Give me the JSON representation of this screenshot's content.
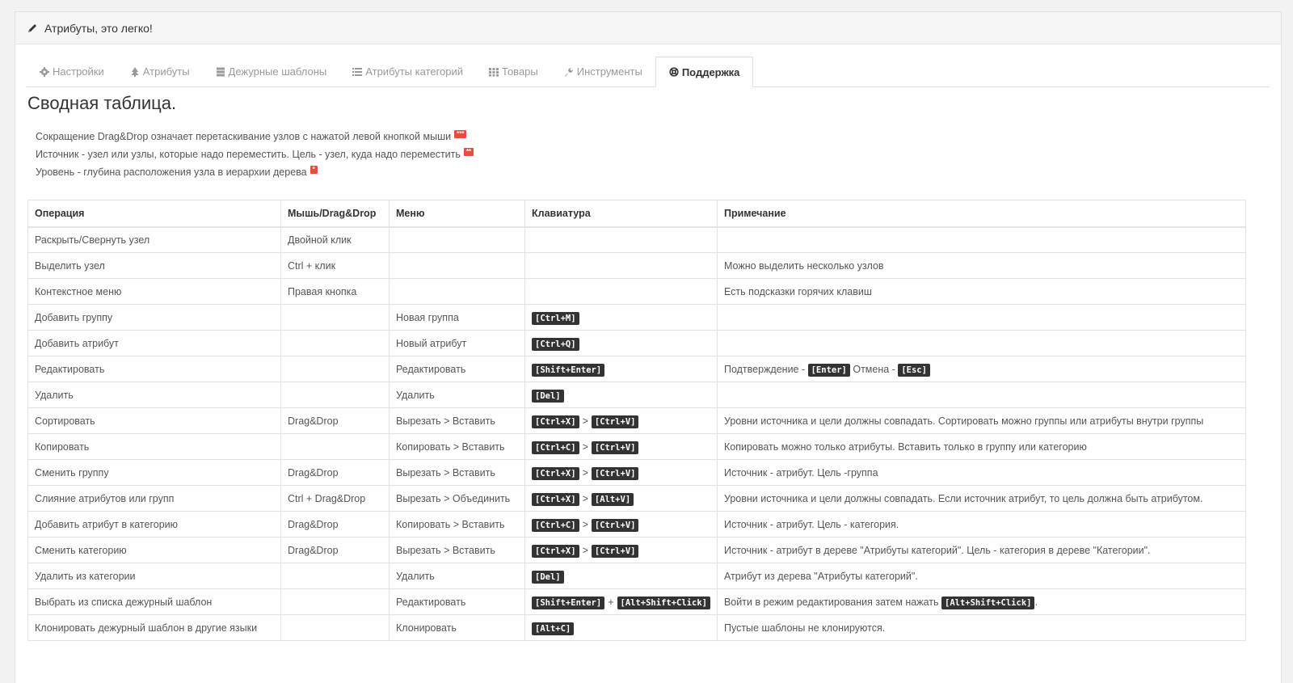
{
  "header": {
    "title": "Атрибуты, это легко!"
  },
  "tabs": [
    {
      "label": "Настройки",
      "icon": "gear-icon"
    },
    {
      "label": "Атрибуты",
      "icon": "tree-icon"
    },
    {
      "label": "Дежурные шаблоны",
      "icon": "database-icon"
    },
    {
      "label": "Атрибуты категорий",
      "icon": "list-icon"
    },
    {
      "label": "Товары",
      "icon": "grid-icon"
    },
    {
      "label": "Инструменты",
      "icon": "wrench-icon"
    },
    {
      "label": "Поддержка",
      "icon": "lifebuoy-icon",
      "active": true
    }
  ],
  "main": {
    "title": "Сводная таблица.",
    "notes": [
      {
        "text": "Сокращение Drag&Drop означает перетаскивание узлов с нажатой левой кнопкой мыши",
        "badge": "***"
      },
      {
        "text": "Источник - узел или узлы, которые надо переместить. Цель - узел, куда надо переместить",
        "badge": "**"
      },
      {
        "text": "Уровень - глубина расположения узла в иерархии дерева",
        "badge": "*"
      }
    ],
    "table": {
      "headers": [
        "Операция",
        "Мышь/Drag&Drop",
        "Меню",
        "Клавиатура",
        "Примечание"
      ],
      "rows": [
        {
          "op": "Раскрыть/Свернуть узел",
          "mouse": "Двойной клик",
          "menu": "",
          "keys": [],
          "note": []
        },
        {
          "op": "Выделить узел",
          "mouse": "Ctrl + клик",
          "menu": "",
          "keys": [],
          "note": [
            {
              "t": "text",
              "v": "Можно выделить несколько узлов"
            }
          ]
        },
        {
          "op": "Контекстное меню",
          "mouse": "Правая кнопка",
          "menu": "",
          "keys": [],
          "note": [
            {
              "t": "text",
              "v": "Есть подсказки горячих клавиш"
            }
          ]
        },
        {
          "op": "Добавить группу",
          "mouse": "",
          "menu": "Новая группа",
          "keys": [
            {
              "t": "kbd",
              "v": "[Ctrl+M]"
            }
          ],
          "note": []
        },
        {
          "op": "Добавить атрибут",
          "mouse": "",
          "menu": "Новый атрибут",
          "keys": [
            {
              "t": "kbd",
              "v": "[Ctrl+Q]"
            }
          ],
          "note": []
        },
        {
          "op": "Редактировать",
          "mouse": "",
          "menu": "Редактировать",
          "keys": [
            {
              "t": "kbd",
              "v": "[Shift+Enter]"
            }
          ],
          "note": [
            {
              "t": "text",
              "v": "Подтверждение - "
            },
            {
              "t": "kbd",
              "v": "[Enter]"
            },
            {
              "t": "text",
              "v": " Отмена - "
            },
            {
              "t": "kbd",
              "v": "[Esc]"
            }
          ]
        },
        {
          "op": "Удалить",
          "mouse": "",
          "menu": "Удалить",
          "keys": [
            {
              "t": "kbd",
              "v": "[Del]"
            }
          ],
          "note": []
        },
        {
          "op": "Сортировать",
          "mouse": "Drag&Drop",
          "menu": "Вырезать > Вставить",
          "keys": [
            {
              "t": "kbd",
              "v": "[Ctrl+X]"
            },
            {
              "t": "sep",
              "v": ">"
            },
            {
              "t": "kbd",
              "v": "[Ctrl+V]"
            }
          ],
          "note": [
            {
              "t": "text",
              "v": "Уровни источника и цели должны совпадать. Сортировать можно группы или атрибуты внутри группы"
            }
          ]
        },
        {
          "op": "Копировать",
          "mouse": "",
          "menu": "Копировать > Вставить",
          "keys": [
            {
              "t": "kbd",
              "v": "[Ctrl+C]"
            },
            {
              "t": "sep",
              "v": ">"
            },
            {
              "t": "kbd",
              "v": "[Ctrl+V]"
            }
          ],
          "note": [
            {
              "t": "text",
              "v": "Копировать можно только атрибуты. Вставить только в группу или категорию"
            }
          ]
        },
        {
          "op": "Сменить группу",
          "mouse": "Drag&Drop",
          "menu": "Вырезать > Вставить",
          "keys": [
            {
              "t": "kbd",
              "v": "[Ctrl+X]"
            },
            {
              "t": "sep",
              "v": ">"
            },
            {
              "t": "kbd",
              "v": "[Ctrl+V]"
            }
          ],
          "note": [
            {
              "t": "text",
              "v": "Источник - атрибут. Цель -группа"
            }
          ]
        },
        {
          "op": "Слияние атрибутов или групп",
          "mouse": "Ctrl + Drag&Drop",
          "menu": "Вырезать > Объединить",
          "keys": [
            {
              "t": "kbd",
              "v": "[Ctrl+X]"
            },
            {
              "t": "sep",
              "v": ">"
            },
            {
              "t": "kbd",
              "v": "[Alt+V]"
            }
          ],
          "note": [
            {
              "t": "text",
              "v": "Уровни источника и цели должны совпадать. Если источник атрибут, то цель должна быть атрибутом."
            }
          ]
        },
        {
          "op": "Добавить атрибут в категорию",
          "mouse": "Drag&Drop",
          "menu": "Копировать > Вставить",
          "keys": [
            {
              "t": "kbd",
              "v": "[Ctrl+C]"
            },
            {
              "t": "sep",
              "v": ">"
            },
            {
              "t": "kbd",
              "v": "[Ctrl+V]"
            }
          ],
          "note": [
            {
              "t": "text",
              "v": "Источник - атрибут. Цель - категория."
            }
          ]
        },
        {
          "op": "Сменить категорию",
          "mouse": "Drag&Drop",
          "menu": "Вырезать > Вставить",
          "keys": [
            {
              "t": "kbd",
              "v": "[Ctrl+X]"
            },
            {
              "t": "sep",
              "v": ">"
            },
            {
              "t": "kbd",
              "v": "[Ctrl+V]"
            }
          ],
          "note": [
            {
              "t": "text",
              "v": "Источник - атрибут в дереве \"Атрибуты категорий\". Цель - категория в дереве \"Категории\"."
            }
          ]
        },
        {
          "op": "Удалить из категории",
          "mouse": "",
          "menu": "Удалить",
          "keys": [
            {
              "t": "kbd",
              "v": "[Del]"
            }
          ],
          "note": [
            {
              "t": "text",
              "v": "Атрибут из дерева \"Атрибуты категорий\"."
            }
          ]
        },
        {
          "op": "Выбрать из списка дежурный шаблон",
          "mouse": "",
          "menu": "Редактировать",
          "keys": [
            {
              "t": "kbd",
              "v": "[Shift+Enter]"
            },
            {
              "t": "sep",
              "v": "+"
            },
            {
              "t": "kbd",
              "v": "[Alt+Shift+Click]"
            }
          ],
          "note": [
            {
              "t": "text",
              "v": "Войти в режим редактирования затем нажать "
            },
            {
              "t": "kbd",
              "v": "[Alt+Shift+Click]"
            },
            {
              "t": "text",
              "v": "."
            }
          ]
        },
        {
          "op": "Клонировать дежурный шаблон в другие языки",
          "mouse": "",
          "menu": "Клонировать",
          "keys": [
            {
              "t": "kbd",
              "v": "[Alt+C]"
            }
          ],
          "note": [
            {
              "t": "text",
              "v": "Пустые шаблоны не клонируются."
            }
          ]
        }
      ]
    }
  }
}
